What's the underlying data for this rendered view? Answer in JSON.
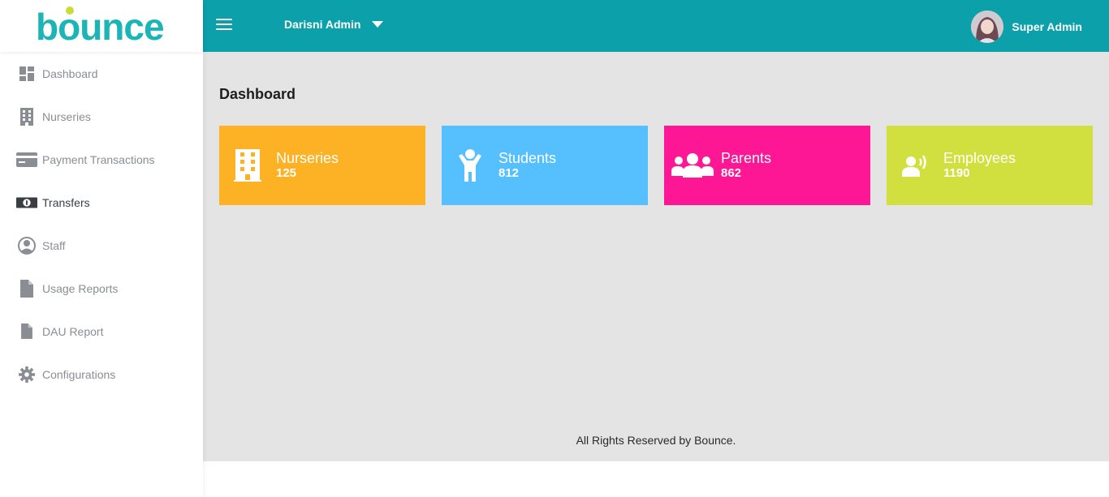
{
  "brand": {
    "logo_text": "bounce",
    "logo_color": "#1bb5b8",
    "logo_dot_color": "#c9dc3a"
  },
  "header": {
    "org_select": "Darisni Admin",
    "user_name": "Super Admin",
    "bg_color": "#0ca0ab"
  },
  "sidebar": {
    "items": [
      {
        "label": "Dashboard",
        "icon": "dashboard-icon",
        "active": false
      },
      {
        "label": "Nurseries",
        "icon": "building-icon",
        "active": false
      },
      {
        "label": "Payment Transactions",
        "icon": "credit-card-icon",
        "active": false
      },
      {
        "label": "Transfers",
        "icon": "money-bill-icon",
        "active": true
      },
      {
        "label": "Staff",
        "icon": "user-circle-icon",
        "active": false
      },
      {
        "label": "Usage Reports",
        "icon": "file-icon",
        "active": false
      },
      {
        "label": "DAU Report",
        "icon": "file-icon",
        "active": false
      },
      {
        "label": "Configurations",
        "icon": "gear-icon",
        "active": false
      }
    ]
  },
  "main": {
    "title": "Dashboard",
    "cards": [
      {
        "label": "Nurseries",
        "value": "125",
        "color": "#fdb225",
        "icon": "building-icon"
      },
      {
        "label": "Students",
        "value": "812",
        "color": "#56bffe",
        "icon": "child-icon"
      },
      {
        "label": "Parents",
        "value": "862",
        "color": "#fd1795",
        "icon": "users-icon"
      },
      {
        "label": "Employees",
        "value": "1190",
        "color": "#d1e03e",
        "icon": "user-voice-icon"
      }
    ],
    "footer": "All Rights Reserved by Bounce."
  }
}
